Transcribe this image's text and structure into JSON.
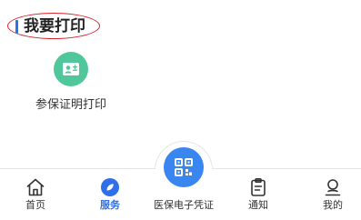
{
  "section": {
    "title": "我要打印"
  },
  "services": [
    {
      "label": "参保证明打印",
      "icon": "id-card-icon",
      "icon_color": "#4fc79a"
    }
  ],
  "tabbar": {
    "accent_color": "#2f6fea",
    "tabs": [
      {
        "label": "首页",
        "icon": "home-icon",
        "active": false
      },
      {
        "label": "服务",
        "icon": "service-icon",
        "active": true
      },
      {
        "label": "医保电子凭证",
        "icon": "qr-code-icon",
        "active": false
      },
      {
        "label": "通知",
        "icon": "clipboard-icon",
        "active": false
      },
      {
        "label": "我的",
        "icon": "user-icon",
        "active": false
      }
    ]
  }
}
